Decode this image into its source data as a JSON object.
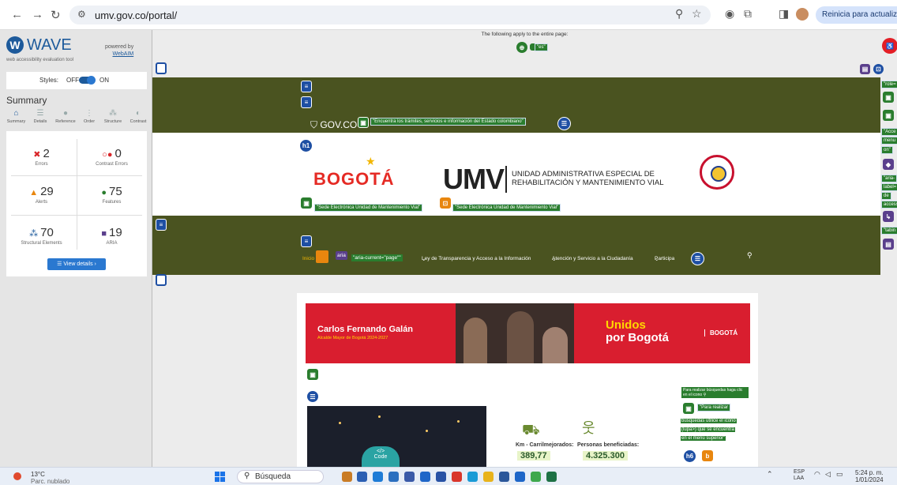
{
  "browser": {
    "url": "umv.gov.co/portal/",
    "update_label": "Reinicia para actualizar"
  },
  "wave": {
    "logo": "WAVE",
    "tagline": "web accessibility evaluation tool",
    "powered_by": "powered by",
    "webaim": "WebAIM",
    "styles_label": "Styles:",
    "styles_off": "OFF",
    "styles_on": "ON",
    "summary_title": "Summary",
    "tabs": [
      {
        "label": "Summary",
        "icon": "home-icon"
      },
      {
        "label": "Details",
        "icon": "list-icon"
      },
      {
        "label": "Reference",
        "icon": "info-icon"
      },
      {
        "label": "Order",
        "icon": "order-icon"
      },
      {
        "label": "Structure",
        "icon": "structure-icon"
      },
      {
        "label": "Contrast",
        "icon": "contrast-icon"
      }
    ],
    "stats": {
      "errors": {
        "value": "2",
        "label": "Errors",
        "color": "#d9262a"
      },
      "contrast": {
        "value": "0",
        "label": "Contrast Errors",
        "color": "#d9262a"
      },
      "alerts": {
        "value": "29",
        "label": "Alerts",
        "color": "#e8860e"
      },
      "features": {
        "value": "75",
        "label": "Features",
        "color": "#2a7d2e"
      },
      "structural": {
        "value": "70",
        "label": "Structural Elements",
        "color": "#1d5a9b"
      },
      "aria": {
        "value": "19",
        "label": "ARIA",
        "color": "#5a3f8c"
      }
    },
    "view_details": "View details ›"
  },
  "page": {
    "applies": "The following apply to the entire page:",
    "lang_label": "\"es\"",
    "h1": "h1",
    "h6": "h6",
    "govco": "GOV.CO",
    "govco_alt": "\"Encuentra los trámites, servicios e información del Estado colombiano\"",
    "bogota_logo": "BOGOTÁ",
    "umv_logo": "UMV",
    "umv_name_line1": "UNIDAD ADMINISTRATIVA ESPECIAL DE",
    "umv_name_line2": "REHABILITACIÓN Y MANTENIMIENTO VIAL",
    "sede_label_1": "\"Sede Electrónica Unidad de Mantenimiento Vial\"",
    "sede_label_2": "\"Sede Electrónica Unidad de Mantenimiento Vial\"",
    "nav": {
      "inicio": "Inicio",
      "aria": "aria",
      "aria_current": "\"aria-current=\"page\"\"",
      "transparencia": "Ley de Transparencia y Acceso a la Información",
      "atencion": "Atención y Servicio a la Ciudadanía",
      "participa": "Participa"
    },
    "banner": {
      "name": "Carlos Fernando Galán",
      "role": "Alcalde Mayor de Bogotá 2024-2027",
      "unidos": "Unidos",
      "por_bogota": "por Bogotá",
      "bogota_small": "BOGOTÁ"
    },
    "kpi1_label": "Km - Carrilmejorados:",
    "kpi1_value": "389,77",
    "kpi2_label": "Personas beneficiadas:",
    "kpi2_value": "4.325.300",
    "search_note": "Para realizar búsquedas haga clic en el icono",
    "search_alt_1": "\"Para realizar",
    "search_alt_2": "búsquedas utilice el icono",
    "search_alt_3": "(lupa>) que se encuentra",
    "search_alt_4": "en el menú superior\"",
    "code_label": "Code",
    "right_labels": [
      "\"role=",
      "\"Acce",
      "menu",
      "on\"",
      "\"aria-",
      "label=",
      "de",
      "access",
      "\"tabin"
    ]
  },
  "taskbar": {
    "temp": "13°C",
    "weather": "Parc. nublado",
    "search": "Búsqueda",
    "lang1": "ESP",
    "lang2": "LAA",
    "time": "5:24 p. m.",
    "date": "1/01/2024"
  }
}
